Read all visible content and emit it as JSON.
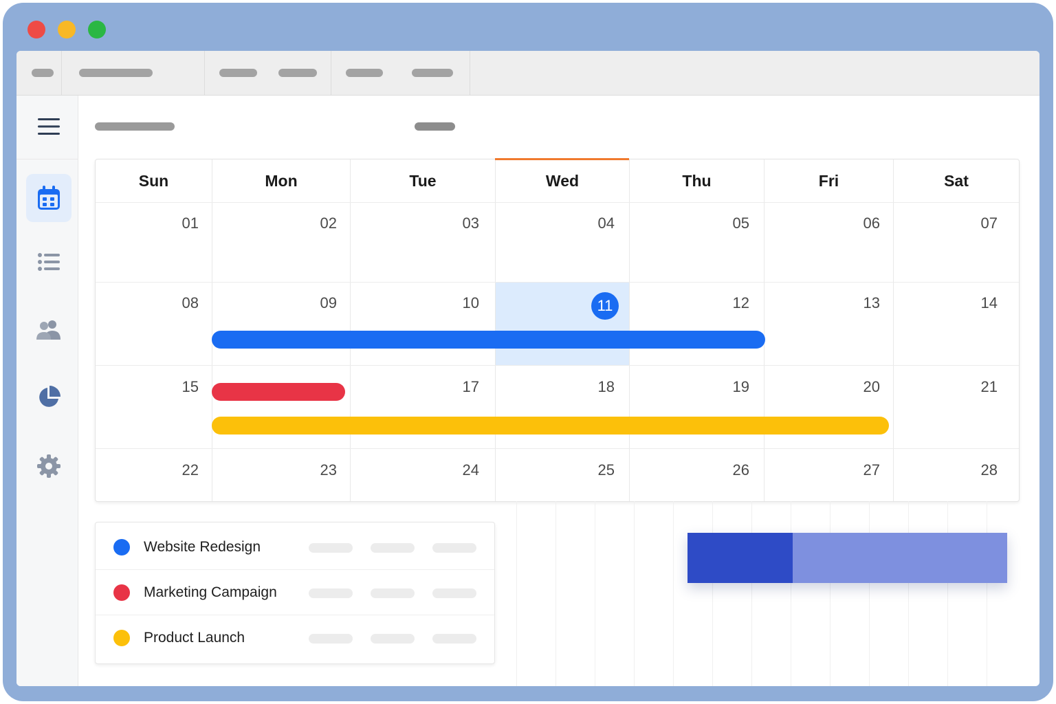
{
  "window_controls": {
    "close_color": "#ee4b45",
    "minimize_color": "#f8b826",
    "maximize_color": "#2bb743"
  },
  "sidebar": {
    "items": [
      {
        "icon": "menu-icon",
        "active": false
      },
      {
        "icon": "calendar-icon",
        "active": true
      },
      {
        "icon": "list-icon",
        "active": false
      },
      {
        "icon": "users-icon",
        "active": false
      },
      {
        "icon": "pie-chart-icon",
        "active": false
      },
      {
        "icon": "gear-icon",
        "active": false
      }
    ]
  },
  "calendar": {
    "weekdays": [
      "Sun",
      "Mon",
      "Tue",
      "Wed",
      "Thu",
      "Fri",
      "Sat"
    ],
    "current_weekday": "Wed",
    "weeks": [
      [
        "01",
        "02",
        "03",
        "04",
        "05",
        "06",
        "07"
      ],
      [
        "08",
        "09",
        "10",
        "11",
        "12",
        "13",
        "14"
      ],
      [
        "15",
        "",
        "17",
        "18",
        "19",
        "20",
        "21"
      ],
      [
        "22",
        "23",
        "24",
        "25",
        "26",
        "27",
        "28"
      ]
    ],
    "today": "11",
    "events": [
      {
        "name": "Website Redesign",
        "color": "#1a6cf2",
        "start": "09",
        "end": "13"
      },
      {
        "name": "Marketing Campaign",
        "color": "#e83446",
        "start": "16",
        "end": "16"
      },
      {
        "name": "Product Launch",
        "color": "#fcc00a",
        "start": "16",
        "end": "21"
      }
    ]
  },
  "legend": [
    {
      "label": "Website Redesign",
      "color": "#1a6cf2"
    },
    {
      "label": "Marketing Campaign",
      "color": "#e83446"
    },
    {
      "label": "Product Launch",
      "color": "#fcc00a"
    }
  ],
  "progress": {
    "fraction": 0.33,
    "fill_color": "#2e4bc6",
    "track_color": "#7e90df"
  },
  "colors": {
    "accent_blue": "#1a6cf2",
    "wed_indicator": "#f07a2d",
    "today_highlight": "#dcebfd",
    "frame": "#8fadd8"
  }
}
